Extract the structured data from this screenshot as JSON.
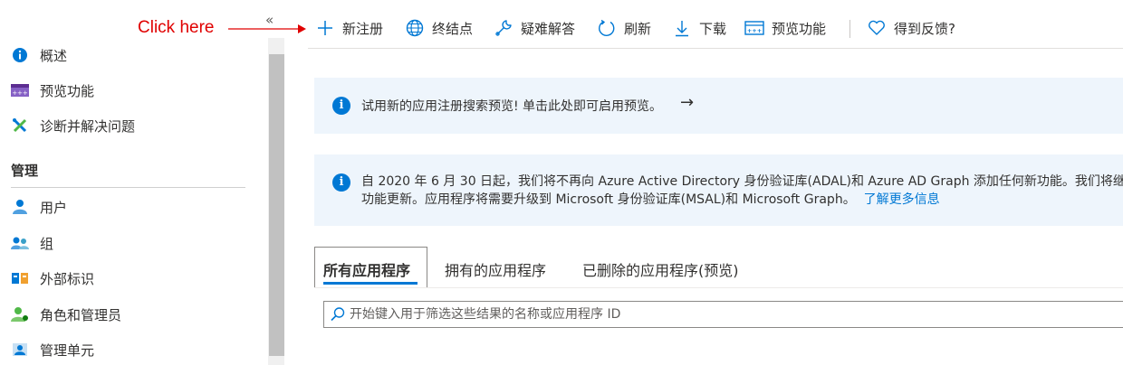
{
  "annotation": {
    "text": "Click here"
  },
  "sidebar": {
    "collapse_glyph": "«",
    "items_top": [
      {
        "label": "概述",
        "icon": "info-icon"
      },
      {
        "label": "预览功能",
        "icon": "preview-features-icon"
      },
      {
        "label": "诊断并解决问题",
        "icon": "wrench-cross-icon"
      }
    ],
    "section_title": "管理",
    "items_manage": [
      {
        "label": "用户",
        "icon": "user-icon"
      },
      {
        "label": "组",
        "icon": "group-icon"
      },
      {
        "label": "外部标识",
        "icon": "external-identities-icon"
      },
      {
        "label": "角色和管理员",
        "icon": "roles-admins-icon"
      },
      {
        "label": "管理单元",
        "icon": "admin-units-icon"
      }
    ]
  },
  "toolbar": {
    "new_registration": "新注册",
    "endpoints": "终结点",
    "troubleshooting": "疑难解答",
    "refresh": "刷新",
    "download": "下载",
    "preview_features": "预览功能",
    "feedback": "得到反馈?"
  },
  "banners": {
    "search_preview": {
      "text": "试用新的应用注册搜索预览! 单击此处即可启用预览。",
      "arrow": "→"
    },
    "adal_notice": {
      "line1": "自 2020 年 6 月 30 日起，我们将不再向 Azure Active Directory 身份验证库(ADAL)和 Azure AD Graph 添加任何新功能。我们将继续",
      "line2": "功能更新。应用程序将需要升级到 Microsoft 身份验证库(MSAL)和 Microsoft Graph。",
      "link": "了解更多信息"
    }
  },
  "tabs": [
    {
      "label": "所有应用程序",
      "active": true
    },
    {
      "label": "拥有的应用程序",
      "active": false
    },
    {
      "label": "已删除的应用程序(预览)",
      "active": false
    }
  ],
  "filter": {
    "placeholder": "开始键入用于筛选这些结果的名称或应用程序 ID",
    "value": ""
  },
  "colors": {
    "accent": "#0078d4",
    "annotation": "#e00000",
    "banner_bg": "#eef5fc"
  }
}
